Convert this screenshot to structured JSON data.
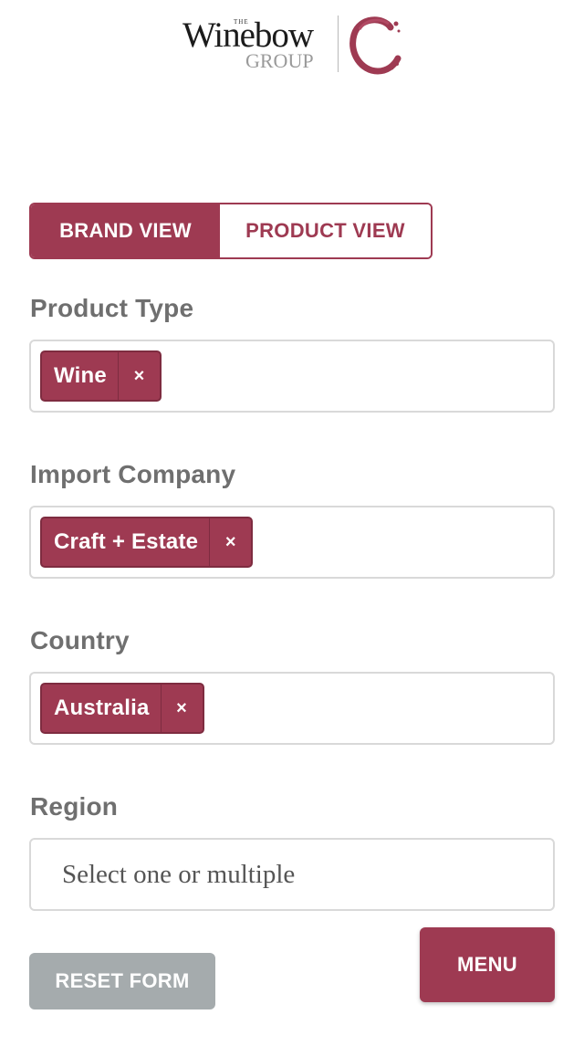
{
  "brand": {
    "the": "THE",
    "name": "Winebow",
    "group": "GROUP",
    "accent_color": "#9e3a52"
  },
  "view_toggle": {
    "brand_view": "BRAND VIEW",
    "product_view": "PRODUCT VIEW",
    "active": "brand_view"
  },
  "filters": {
    "product_type": {
      "label": "Product Type",
      "selected": [
        "Wine"
      ]
    },
    "import_company": {
      "label": "Import Company",
      "selected": [
        "Craft + Estate"
      ]
    },
    "country": {
      "label": "Country",
      "selected": [
        "Australia"
      ]
    },
    "region": {
      "label": "Region",
      "placeholder": "Select one or multiple"
    }
  },
  "tag_remove_glyph": "×",
  "buttons": {
    "reset": "RESET FORM",
    "menu": "MENU"
  }
}
